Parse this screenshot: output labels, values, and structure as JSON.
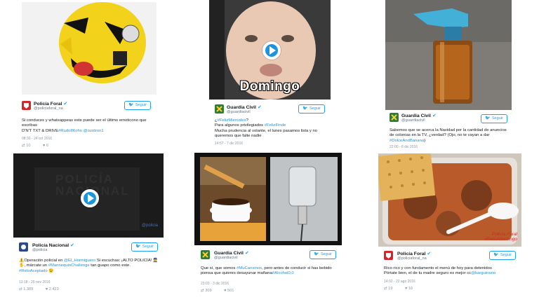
{
  "follow_label": "Seguir",
  "cards": [
    {
      "account": "Policía Foral",
      "handle": "@policiaforal_na",
      "text_parts": [
        "Si conduces y whatsappeas este puede ser el último emoticono que escribas",
        "D'N'T TXT & DRIVE",
        "#RudolfKohn @ozotron1"
      ],
      "timestamp": "08:30 - 24 oct 2016",
      "retweets": "10",
      "likes": "6"
    },
    {
      "account": "Guardia Civil",
      "handle": "@guardiacivil",
      "overlay_caption": "Domingo",
      "text_parts": [
        "¿",
        "#FelizMiercoles",
        "?",
        "Para algunos privilegiados",
        "#FelizFinde",
        "Mucha prudencia al volante, el lunes pasamos lista y no queremos que falte nadie"
      ],
      "timestamp": "14:57 - 7 dic 2016"
    },
    {
      "account": "Guardia Civil",
      "handle": "@guardiacivil",
      "text_parts": [
        "Sabemos que se acerca la Navidad por la cantidad de anuncios de colonias en la TV, ¿verdad? (Ojo, no te vayan a dar",
        "#DolceAndBanana",
        ")"
      ],
      "timestamp": "22:00 - 8 dic 2016"
    },
    {
      "account": "Policía Nacional",
      "handle": "@policia",
      "video_watermark": "POLICÍA NACIONAL",
      "video_tag": "@policia",
      "text_parts": [
        "⚠️Operación policial en ",
        "@El_Hormiguero",
        " Si escuchas: ¡ALTO POLICÍA! 👮 ✋, márcate un ",
        "#MannequinChallenge",
        " tan guapo como este. ",
        "#RetoAceptado",
        " 😉"
      ],
      "timestamp": "13:18 - 29 nov 2016",
      "retweets": "1.389",
      "likes": "2.423"
    },
    {
      "account": "Guardia Civil",
      "handle": "@guardiacivil",
      "text_parts": [
        "Que sí, que somos ",
        "#MuCansinos",
        ", pero antes de conducir si has bebido piensa que quieres desayunar mañana",
        "#Alcohol0,0"
      ],
      "timestamp": "23:03 - 3 dic 2016",
      "retweets": "309",
      "likes": "501"
    },
    {
      "account": "Policía Foral",
      "handle": "@policiaforal_na",
      "image_watermark": "Policía Foral #RetoAlterlango",
      "text_parts": [
        "Rico rico y con fundamento el menú de hoy para detenidos",
        "Pórtate bien, el de tu madre seguro es mejor cc",
        "@karguinano"
      ],
      "timestamp": "14:02 - 22 ago 2016",
      "retweets": "19",
      "likes": "16"
    }
  ],
  "colors": {
    "link": "#1b95e0",
    "follow_border": "#1da1f2",
    "foral_red": "#d4262b",
    "guardia_green": "#2e7d32",
    "nacional_blue": "#2a4a8f"
  }
}
